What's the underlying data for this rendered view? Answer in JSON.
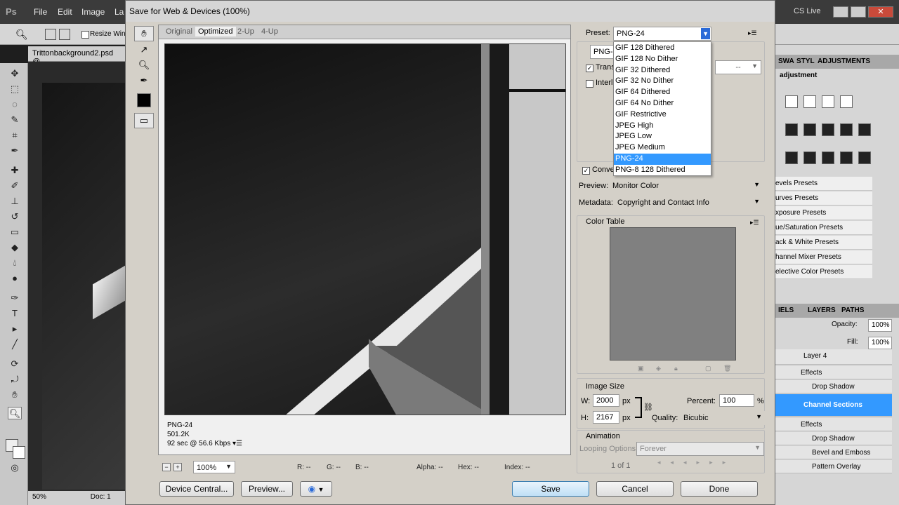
{
  "ps": {
    "logo": "Ps",
    "menu": [
      "File",
      "Edit",
      "Image",
      "La"
    ],
    "cs_live": "CS Live",
    "resize_label": "Resize Wind",
    "doc_tab": "Trittonbackground2.psd @",
    "zoom_status": "50%",
    "doc_status": "Doc: 1"
  },
  "dialog": {
    "title": "Save for Web & Devices (100%)",
    "tabs": [
      "Original",
      "Optimized",
      "2-Up",
      "4-Up"
    ],
    "info": {
      "format": "PNG-24",
      "size": "501.2K",
      "speed": "92 sec @ 56.6 Kbps"
    },
    "zoom": "100%",
    "readouts": {
      "r": "R: --",
      "g": "G: --",
      "b": "B: --",
      "alpha": "Alpha: --",
      "hex": "Hex: --",
      "index": "Index: --"
    },
    "buttons": {
      "device_central": "Device Central...",
      "preview": "Preview...",
      "save": "Save",
      "cancel": "Cancel",
      "done": "Done"
    }
  },
  "settings": {
    "preset_label": "Preset:",
    "preset_value": "PNG-24",
    "format_value": "PNG-2",
    "transparency_label": "Transp",
    "interlaced_label": "Interla",
    "matte_value": "--",
    "dropdown_items": [
      "GIF 128 Dithered",
      "GIF 128 No Dither",
      "GIF 32 Dithered",
      "GIF 32 No Dither",
      "GIF 64 Dithered",
      "GIF 64 No Dither",
      "GIF Restrictive",
      "JPEG High",
      "JPEG Low",
      "JPEG Medium",
      "PNG-24",
      "PNG-8 128 Dithered"
    ],
    "dropdown_selected": "PNG-24",
    "convert_label": "Conve",
    "preview_label": "Preview:",
    "preview_value": "Monitor Color",
    "metadata_label": "Metadata:",
    "metadata_value": "Copyright and Contact Info",
    "color_table_label": "Color Table",
    "image_size_label": "Image Size",
    "w_label": "W:",
    "w_value": "2000",
    "h_label": "H:",
    "h_value": "2167",
    "px": "px",
    "percent_label": "Percent:",
    "percent_value": "100",
    "percent_unit": "%",
    "quality_label": "Quality:",
    "quality_value": "Bicubic",
    "animation_label": "Animation",
    "looping_label": "Looping Options:",
    "looping_value": "Forever",
    "frame_count": "1 of 1"
  },
  "panels": {
    "top_tabs": [
      "SWA",
      "STYL",
      "ADJUSTMENTS"
    ],
    "adj_header": "adjustment",
    "presets": [
      "evels Presets",
      "urves Presets",
      "xposure Presets",
      "ue/Saturation Presets",
      "ack & White Presets",
      "hannel Mixer Presets",
      "elective Color Presets"
    ],
    "layer_tabs": [
      "IELS",
      "LAYERS",
      "PATHS"
    ],
    "opacity_label": "Opacity:",
    "opacity_value": "100%",
    "fill_label": "Fill:",
    "fill_value": "100%",
    "layers": [
      "Layer 4",
      "Effects",
      "Drop Shadow",
      "Channel Sections",
      "Effects",
      "Drop Shadow",
      "Bevel and Emboss",
      "Pattern Overlay"
    ]
  }
}
